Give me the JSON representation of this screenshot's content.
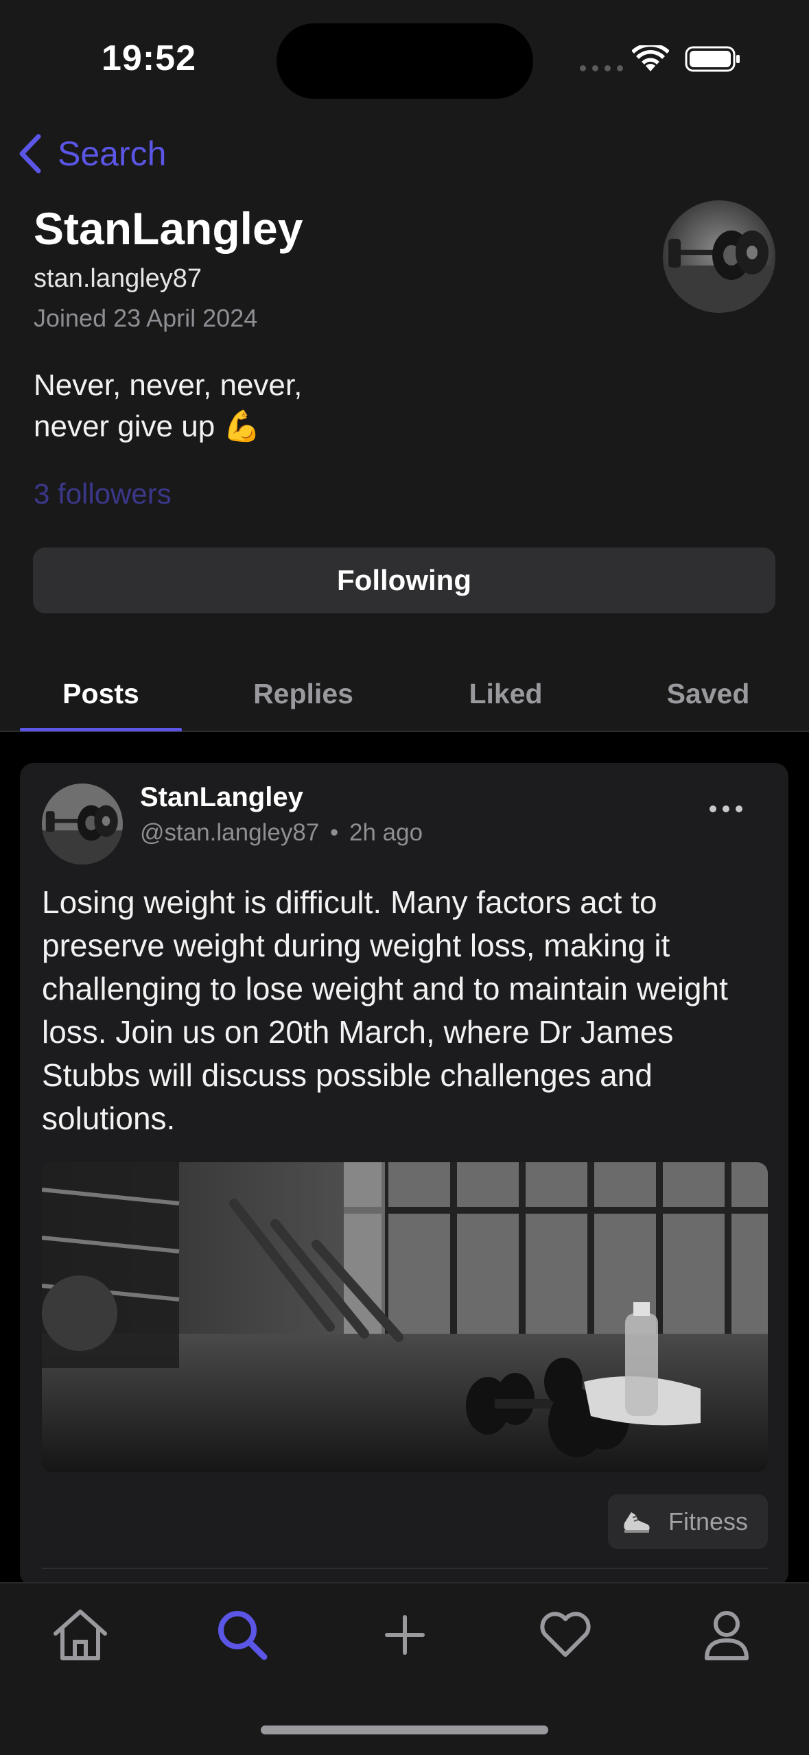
{
  "status_bar": {
    "time": "19:52"
  },
  "nav": {
    "back_label": "Search"
  },
  "profile": {
    "display_name": "StanLangley",
    "handle": "stan.langley87",
    "joined": "Joined 23 April 2024",
    "bio_line1": "Never, never, never,",
    "bio_line2": "never give up 💪",
    "followers": "3 followers",
    "follow_button": "Following"
  },
  "tabs": [
    {
      "label": "Posts",
      "active": true
    },
    {
      "label": "Replies",
      "active": false
    },
    {
      "label": "Liked",
      "active": false
    },
    {
      "label": "Saved",
      "active": false
    }
  ],
  "post": {
    "author": "StanLangley",
    "handle": "@stan.langley87",
    "separator": "•",
    "time_ago": "2h ago",
    "text": "Losing weight is difficult. Many factors act to preserve weight during weight loss, making it challenging to lose weight and to maintain weight loss. Join us on 20th March, where Dr James Stubbs will discuss possible challenges and solutions.",
    "tag": "Fitness",
    "tag_icon": "sneaker-icon"
  },
  "tab_bar": {
    "items": [
      "home-icon",
      "search-icon",
      "plus-icon",
      "heart-icon",
      "person-icon"
    ],
    "active": "search-icon"
  },
  "colors": {
    "accent": "#5b56e6",
    "followers": "#3b3789",
    "background": "#19191a",
    "card": "#1c1c1e"
  }
}
